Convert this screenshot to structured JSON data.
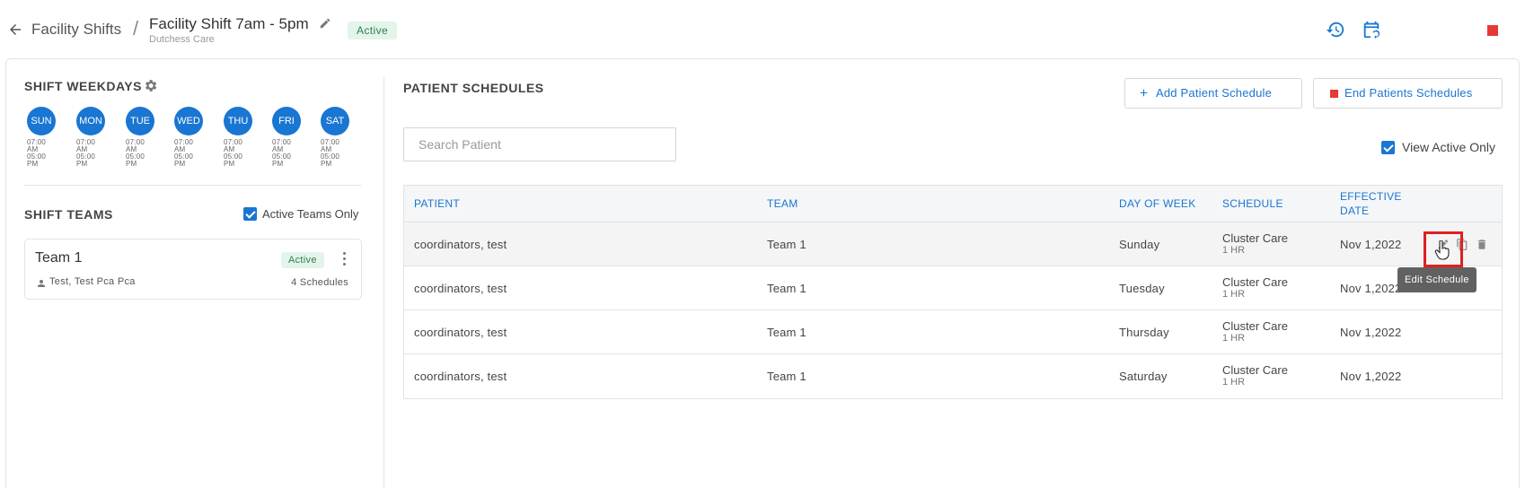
{
  "header": {
    "breadcrumb": "Facility Shifts",
    "separator": "/",
    "title": "Facility Shift 7am - 5pm",
    "subtitle": "Dutchess Care",
    "status": "Active"
  },
  "shift_weekdays": {
    "title": "SHIFT WEEKDAYS",
    "days": [
      {
        "label": "SUN",
        "start": "07:00",
        "start_ampm": "AM",
        "end": "05:00",
        "end_ampm": "PM"
      },
      {
        "label": "MON",
        "start": "07:00",
        "start_ampm": "AM",
        "end": "05:00",
        "end_ampm": "PM"
      },
      {
        "label": "TUE",
        "start": "07:00",
        "start_ampm": "AM",
        "end": "05:00",
        "end_ampm": "PM"
      },
      {
        "label": "WED",
        "start": "07:00",
        "start_ampm": "AM",
        "end": "05:00",
        "end_ampm": "PM"
      },
      {
        "label": "THU",
        "start": "07:00",
        "start_ampm": "AM",
        "end": "05:00",
        "end_ampm": "PM"
      },
      {
        "label": "FRI",
        "start": "07:00",
        "start_ampm": "AM",
        "end": "05:00",
        "end_ampm": "PM"
      },
      {
        "label": "SAT",
        "start": "07:00",
        "start_ampm": "AM",
        "end": "05:00",
        "end_ampm": "PM"
      }
    ]
  },
  "shift_teams": {
    "title": "SHIFT TEAMS",
    "filter_label": "Active Teams Only",
    "filter_checked": true,
    "teams": [
      {
        "name": "Team 1",
        "status": "Active",
        "members": "Test, Test Pca Pca",
        "schedules": "4 Schedules"
      }
    ]
  },
  "patient_schedules": {
    "title": "PATIENT SCHEDULES",
    "add_button": "Add Patient Schedule",
    "end_button": "End Patients Schedules",
    "search_placeholder": "Search Patient",
    "search_value": "",
    "view_active_label": "View Active Only",
    "view_active_checked": true,
    "columns": {
      "patient": "PATIENT",
      "team": "TEAM",
      "day": "DAY OF WEEK",
      "schedule": "SCHEDULE",
      "effective_line1": "EFFECTIVE",
      "effective_line2": "DATE"
    },
    "rows": [
      {
        "patient": "coordinators, test",
        "team": "Team 1",
        "day": "Sunday",
        "schedule": "Cluster Care",
        "duration": "1 HR",
        "effective": "Nov 1,2022"
      },
      {
        "patient": "coordinators, test",
        "team": "Team 1",
        "day": "Tuesday",
        "schedule": "Cluster Care",
        "duration": "1 HR",
        "effective": "Nov 1,2022"
      },
      {
        "patient": "coordinators, test",
        "team": "Team 1",
        "day": "Thursday",
        "schedule": "Cluster Care",
        "duration": "1 HR",
        "effective": "Nov 1,2022"
      },
      {
        "patient": "coordinators, test",
        "team": "Team 1",
        "day": "Saturday",
        "schedule": "Cluster Care",
        "duration": "1 HR",
        "effective": "Nov 1,2022"
      }
    ],
    "tooltip": "Edit Schedule"
  },
  "icons": {
    "back": "arrow-left-icon",
    "title_edit": "pencil-icon",
    "history": "history-icon",
    "calendar": "calendar-sync-icon",
    "stop": "stop-icon",
    "gear": "gear-icon",
    "person": "person-icon",
    "edit": "pencil-icon",
    "copy": "copy-icon",
    "delete": "trash-icon"
  },
  "colors": {
    "accent": "#1976d2",
    "stop": "#e53935",
    "active_badge_bg": "#e3f5ea",
    "active_badge_text": "#2e7d4f",
    "highlight": "#e02020"
  }
}
